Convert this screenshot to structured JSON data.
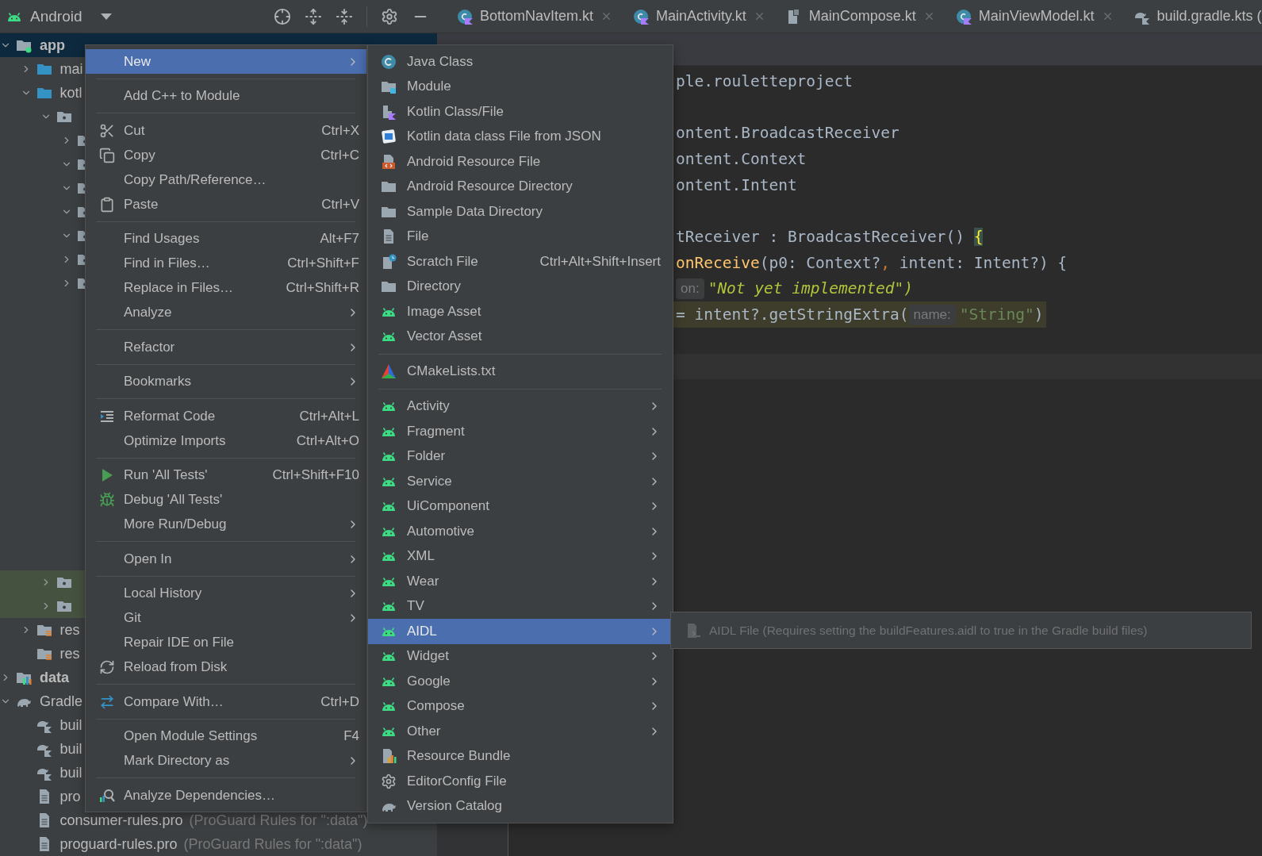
{
  "project_panel": {
    "view": "Android",
    "tree": [
      {
        "label": "app",
        "kind": "android-module",
        "expanded": true,
        "selected": true,
        "highlighted": false,
        "children": [
          {
            "label": "mai",
            "kind": "source-folder",
            "expanded": false,
            "selected": false,
            "highlighted": false
          },
          {
            "label": "kotl",
            "kind": "source-folder",
            "expanded": true,
            "selected": false,
            "highlighted": false,
            "children": [
              {
                "kind": "package",
                "expanded": true,
                "selected": false,
                "highlighted": false,
                "children": [
                  {
                    "kind": "package",
                    "expanded": false,
                    "selected": false,
                    "highlighted": false
                  },
                  {
                    "kind": "package",
                    "expanded": true,
                    "selected": false,
                    "highlighted": false
                  },
                  {
                    "kind": "package",
                    "expanded": true,
                    "selected": false,
                    "highlighted": false
                  },
                  {
                    "kind": "package",
                    "expanded": true,
                    "selected": false,
                    "highlighted": false
                  },
                  {
                    "kind": "package",
                    "expanded": true,
                    "selected": false,
                    "highlighted": false
                  },
                  {
                    "kind": "package",
                    "expanded": false,
                    "selected": false,
                    "highlighted": false
                  },
                  {
                    "kind": "package",
                    "expanded": false,
                    "selected": false,
                    "highlighted": false
                  }
                ]
              },
              {
                "kind": "package",
                "expanded": false,
                "selected": false,
                "highlighted": true
              },
              {
                "kind": "package",
                "expanded": false,
                "selected": false,
                "highlighted": true
              }
            ]
          },
          {
            "label": "res",
            "kind": "resource-folder",
            "expanded": false,
            "selected": false,
            "highlighted": false
          },
          {
            "label": "res",
            "kind": "resource-folder",
            "selected": false,
            "highlighted": false
          }
        ]
      },
      {
        "label": "data",
        "kind": "library-module",
        "expanded": false,
        "selected": false,
        "highlighted": false
      },
      {
        "label": "Gradle",
        "kind": "gradle-root",
        "expanded": true,
        "selected": false,
        "highlighted": false,
        "children": [
          {
            "label": "buil",
            "kind": "gradle-script",
            "selected": false,
            "highlighted": false
          },
          {
            "label": "buil",
            "kind": "gradle-script",
            "selected": false,
            "highlighted": false
          },
          {
            "label": "buil",
            "kind": "gradle-script",
            "selected": false,
            "highlighted": false
          },
          {
            "label": "pro",
            "kind": "text-file",
            "selected": false,
            "highlighted": false
          },
          {
            "label": "consumer-rules.pro",
            "note": "(ProGuard Rules for \":data\")",
            "kind": "text-file",
            "selected": false,
            "highlighted": false
          },
          {
            "label": "proguard-rules.pro",
            "note": "(ProGuard Rules for \":data\")",
            "kind": "text-file",
            "selected": false,
            "highlighted": false
          }
        ]
      }
    ]
  },
  "tabs": [
    {
      "label": "BottomNavItem.kt",
      "kind": "kotlin-class"
    },
    {
      "label": "MainActivity.kt",
      "kind": "kotlin-class"
    },
    {
      "label": "MainCompose.kt",
      "kind": "compose-file"
    },
    {
      "label": "MainViewModel.kt",
      "kind": "kotlin-class"
    },
    {
      "label": "build.gradle.kts (",
      "kind": "gradle-script"
    }
  ],
  "editor": {
    "lines": [
      {
        "kind": "code",
        "highlighted": false,
        "tokens": [
          {
            "text": "ple.rouletteproject",
            "kind": "plain"
          }
        ]
      },
      {
        "kind": "blank",
        "highlighted": false
      },
      {
        "kind": "code",
        "highlighted": false,
        "tokens": [
          {
            "text": "ontent.BroadcastReceiver",
            "kind": "plain"
          }
        ]
      },
      {
        "kind": "code",
        "highlighted": false,
        "tokens": [
          {
            "text": "ontent.Context",
            "kind": "plain"
          }
        ]
      },
      {
        "kind": "code",
        "highlighted": false,
        "tokens": [
          {
            "text": "ontent.Intent",
            "kind": "plain"
          }
        ]
      },
      {
        "kind": "blank",
        "highlighted": false
      },
      {
        "kind": "code",
        "highlighted": false,
        "tokens": [
          {
            "text": "tReceiver : BroadcastReceiver() ",
            "kind": "plain"
          },
          {
            "text": "{",
            "kind": "brace-match"
          }
        ]
      },
      {
        "kind": "code",
        "highlighted": false,
        "tokens": [
          {
            "text": "onReceive",
            "kind": "function"
          },
          {
            "text": "(p0: Context?",
            "kind": "plain"
          },
          {
            "text": ",",
            "kind": "keyword"
          },
          {
            "text": " intent: Intent?) {",
            "kind": "plain"
          }
        ]
      },
      {
        "kind": "code",
        "highlighted": false,
        "tokens": [
          {
            "text": "on:",
            "kind": "hint"
          },
          {
            "text": "\"Not yet implemented\")",
            "kind": "todo-string"
          }
        ]
      },
      {
        "kind": "code",
        "highlighted": true,
        "tokens": [
          {
            "text": "= intent?.getStringExtra(",
            "kind": "plain"
          },
          {
            "text": "name:",
            "kind": "hint"
          },
          {
            "text": "\"String\"",
            "kind": "string"
          },
          {
            "text": ")",
            "kind": "plain"
          }
        ]
      },
      {
        "kind": "blank",
        "highlighted": false
      },
      {
        "kind": "caret-line",
        "highlighted": false
      }
    ]
  },
  "context_menu": {
    "items": [
      {
        "kind": "item",
        "label": "New",
        "submenu": true,
        "selected": true
      },
      {
        "kind": "separator"
      },
      {
        "kind": "item",
        "label": "Add C++ to Module",
        "submenu": false,
        "selected": false
      },
      {
        "kind": "separator"
      },
      {
        "kind": "item",
        "label": "Cut",
        "shortcut": "Ctrl+X",
        "submenu": false,
        "selected": false
      },
      {
        "kind": "item",
        "label": "Copy",
        "shortcut": "Ctrl+C",
        "submenu": false,
        "selected": false
      },
      {
        "kind": "item",
        "label": "Copy Path/Reference…",
        "submenu": false,
        "selected": false
      },
      {
        "kind": "item",
        "label": "Paste",
        "shortcut": "Ctrl+V",
        "submenu": false,
        "selected": false
      },
      {
        "kind": "separator"
      },
      {
        "kind": "item",
        "label": "Find Usages",
        "shortcut": "Alt+F7",
        "submenu": false,
        "selected": false
      },
      {
        "kind": "item",
        "label": "Find in Files…",
        "shortcut": "Ctrl+Shift+F",
        "submenu": false,
        "selected": false
      },
      {
        "kind": "item",
        "label": "Replace in Files…",
        "shortcut": "Ctrl+Shift+R",
        "submenu": false,
        "selected": false
      },
      {
        "kind": "item",
        "label": "Analyze",
        "submenu": true,
        "selected": false
      },
      {
        "kind": "separator"
      },
      {
        "kind": "item",
        "label": "Refactor",
        "submenu": true,
        "selected": false
      },
      {
        "kind": "separator"
      },
      {
        "kind": "item",
        "label": "Bookmarks",
        "submenu": true,
        "selected": false
      },
      {
        "kind": "separator"
      },
      {
        "kind": "item",
        "label": "Reformat Code",
        "shortcut": "Ctrl+Alt+L",
        "submenu": false,
        "selected": false
      },
      {
        "kind": "item",
        "label": "Optimize Imports",
        "shortcut": "Ctrl+Alt+O",
        "submenu": false,
        "selected": false
      },
      {
        "kind": "separator"
      },
      {
        "kind": "item",
        "label": "Run 'All Tests'",
        "shortcut": "Ctrl+Shift+F10",
        "submenu": false,
        "selected": false
      },
      {
        "kind": "item",
        "label": "Debug 'All Tests'",
        "submenu": false,
        "selected": false
      },
      {
        "kind": "item",
        "label": "More Run/Debug",
        "submenu": true,
        "selected": false
      },
      {
        "kind": "separator"
      },
      {
        "kind": "item",
        "label": "Open In",
        "submenu": true,
        "selected": false
      },
      {
        "kind": "separator"
      },
      {
        "kind": "item",
        "label": "Local History",
        "submenu": true,
        "selected": false
      },
      {
        "kind": "item",
        "label": "Git",
        "submenu": true,
        "selected": false
      },
      {
        "kind": "item",
        "label": "Repair IDE on File",
        "submenu": false,
        "selected": false
      },
      {
        "kind": "item",
        "label": "Reload from Disk",
        "submenu": false,
        "selected": false
      },
      {
        "kind": "separator"
      },
      {
        "kind": "item",
        "label": "Compare With…",
        "shortcut": "Ctrl+D",
        "submenu": false,
        "selected": false
      },
      {
        "kind": "separator"
      },
      {
        "kind": "item",
        "label": "Open Module Settings",
        "shortcut": "F4",
        "submenu": false,
        "selected": false
      },
      {
        "kind": "item",
        "label": "Mark Directory as",
        "submenu": true,
        "selected": false
      },
      {
        "kind": "separator"
      },
      {
        "kind": "item",
        "label": "Analyze Dependencies…",
        "submenu": false,
        "selected": false
      }
    ]
  },
  "new_submenu": {
    "items": [
      {
        "kind": "item",
        "label": "Java Class",
        "submenu": false,
        "selected": false
      },
      {
        "kind": "item",
        "label": "Module",
        "submenu": false,
        "selected": false
      },
      {
        "kind": "item",
        "label": "Kotlin Class/File",
        "submenu": false,
        "selected": false
      },
      {
        "kind": "item",
        "label": "Kotlin data class File from JSON",
        "submenu": false,
        "selected": false
      },
      {
        "kind": "item",
        "label": "Android Resource File",
        "submenu": false,
        "selected": false
      },
      {
        "kind": "item",
        "label": "Android Resource Directory",
        "submenu": false,
        "selected": false
      },
      {
        "kind": "item",
        "label": "Sample Data Directory",
        "submenu": false,
        "selected": false
      },
      {
        "kind": "item",
        "label": "File",
        "submenu": false,
        "selected": false
      },
      {
        "kind": "item",
        "label": "Scratch File",
        "shortcut": "Ctrl+Alt+Shift+Insert",
        "submenu": false,
        "selected": false
      },
      {
        "kind": "item",
        "label": "Directory",
        "submenu": false,
        "selected": false
      },
      {
        "kind": "item",
        "label": "Image Asset",
        "submenu": false,
        "selected": false
      },
      {
        "kind": "item",
        "label": "Vector Asset",
        "submenu": false,
        "selected": false
      },
      {
        "kind": "separator"
      },
      {
        "kind": "item",
        "label": "CMakeLists.txt",
        "submenu": false,
        "selected": false
      },
      {
        "kind": "separator"
      },
      {
        "kind": "item",
        "label": "Activity",
        "submenu": true,
        "selected": false
      },
      {
        "kind": "item",
        "label": "Fragment",
        "submenu": true,
        "selected": false
      },
      {
        "kind": "item",
        "label": "Folder",
        "submenu": true,
        "selected": false
      },
      {
        "kind": "item",
        "label": "Service",
        "submenu": true,
        "selected": false
      },
      {
        "kind": "item",
        "label": "UiComponent",
        "submenu": true,
        "selected": false
      },
      {
        "kind": "item",
        "label": "Automotive",
        "submenu": true,
        "selected": false
      },
      {
        "kind": "item",
        "label": "XML",
        "submenu": true,
        "selected": false
      },
      {
        "kind": "item",
        "label": "Wear",
        "submenu": true,
        "selected": false
      },
      {
        "kind": "item",
        "label": "TV",
        "submenu": true,
        "selected": false
      },
      {
        "kind": "item",
        "label": "AIDL",
        "submenu": true,
        "selected": true
      },
      {
        "kind": "item",
        "label": "Widget",
        "submenu": true,
        "selected": false
      },
      {
        "kind": "item",
        "label": "Google",
        "submenu": true,
        "selected": false
      },
      {
        "kind": "item",
        "label": "Compose",
        "submenu": true,
        "selected": false
      },
      {
        "kind": "item",
        "label": "Other",
        "submenu": true,
        "selected": false
      },
      {
        "kind": "item",
        "label": "Resource Bundle",
        "submenu": false,
        "selected": false
      },
      {
        "kind": "item",
        "label": "EditorConfig File",
        "submenu": false,
        "selected": false
      },
      {
        "kind": "item",
        "label": "Version Catalog",
        "submenu": false,
        "selected": false
      }
    ]
  },
  "aidl_submenu": {
    "items": [
      {
        "label": "AIDL File (Requires setting the buildFeatures.aidl to true in the Gradle build files)",
        "disabled": true
      }
    ]
  }
}
